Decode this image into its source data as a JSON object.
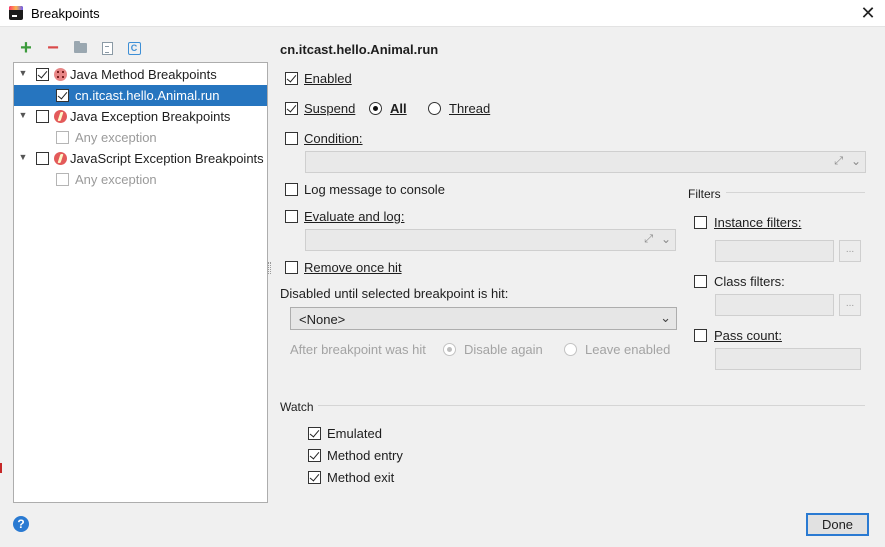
{
  "window": {
    "title": "Breakpoints"
  },
  "toolbar": {
    "add": "+",
    "remove": "−"
  },
  "tree": [
    {
      "label": "Java Method Breakpoints",
      "checked": true,
      "icon": "method-breakpoint-icon"
    },
    {
      "label": "cn.itcast.hello.Animal.run",
      "checked": true,
      "selected": true
    },
    {
      "label": "Java Exception Breakpoints",
      "checked": false,
      "icon": "exception-breakpoint-icon"
    },
    {
      "label": "Any exception",
      "checked": false,
      "disabled": true
    },
    {
      "label": "JavaScript Exception Breakpoints",
      "checked": false,
      "icon": "exception-breakpoint-icon"
    },
    {
      "label": "Any exception",
      "checked": false,
      "disabled": true
    }
  ],
  "details": {
    "title": "cn.itcast.hello.Animal.run",
    "enabled_label": "Enabled",
    "suspend_label": "Suspend",
    "suspend_all": "All",
    "suspend_thread": "Thread",
    "condition_label": "Condition:",
    "log_message_label": "Log message to console",
    "evaluate_label": "Evaluate and log:",
    "remove_once_hit_label": "Remove once hit",
    "disabled_until_label": "Disabled until selected breakpoint is hit:",
    "disabled_until_value": "<None>",
    "after_hit_label": "After breakpoint was hit",
    "disable_again": "Disable again",
    "leave_enabled": "Leave enabled"
  },
  "filters": {
    "title": "Filters",
    "instance_label": "Instance filters:",
    "class_label": "Class filters:",
    "pass_count_label": "Pass count:",
    "dots": "..."
  },
  "watch": {
    "title": "Watch",
    "emulated": "Emulated",
    "method_entry": "Method entry",
    "method_exit": "Method exit"
  },
  "footer": {
    "help": "?",
    "done": "Done"
  },
  "colors": {
    "selection": "#2675bf",
    "accent": "#2a7ad2"
  }
}
